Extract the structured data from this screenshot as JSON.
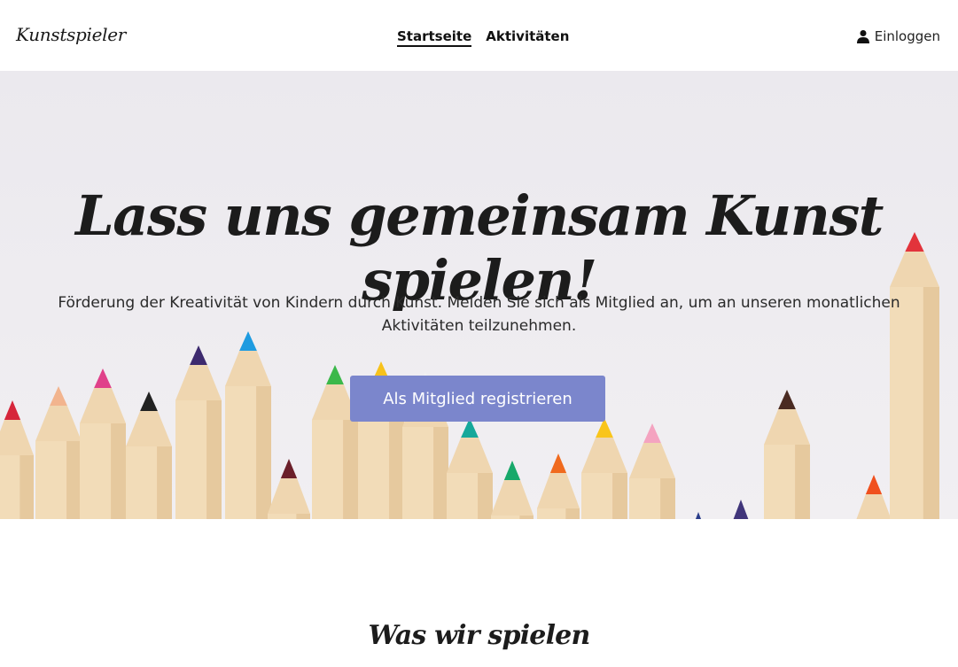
{
  "header": {
    "brand": "Kunstspieler",
    "nav": [
      {
        "label": "Startseite",
        "active": true
      },
      {
        "label": "Aktivitäten",
        "active": false
      }
    ],
    "login_label": "Einloggen",
    "login_icon": "user-icon"
  },
  "hero": {
    "headline": "Lass uns gemeinsam Kunst spielen!",
    "subtext": "Förderung der Kreativität von Kindern durch Kunst. Melden Sie sich als Mitglied an, um an unseren monatlichen Aktivitäten teilzunehmen.",
    "cta_label": "Als Mitglied registrieren",
    "cta_color": "#7b86cc"
  },
  "section": {
    "title": "Was wir spielen"
  }
}
